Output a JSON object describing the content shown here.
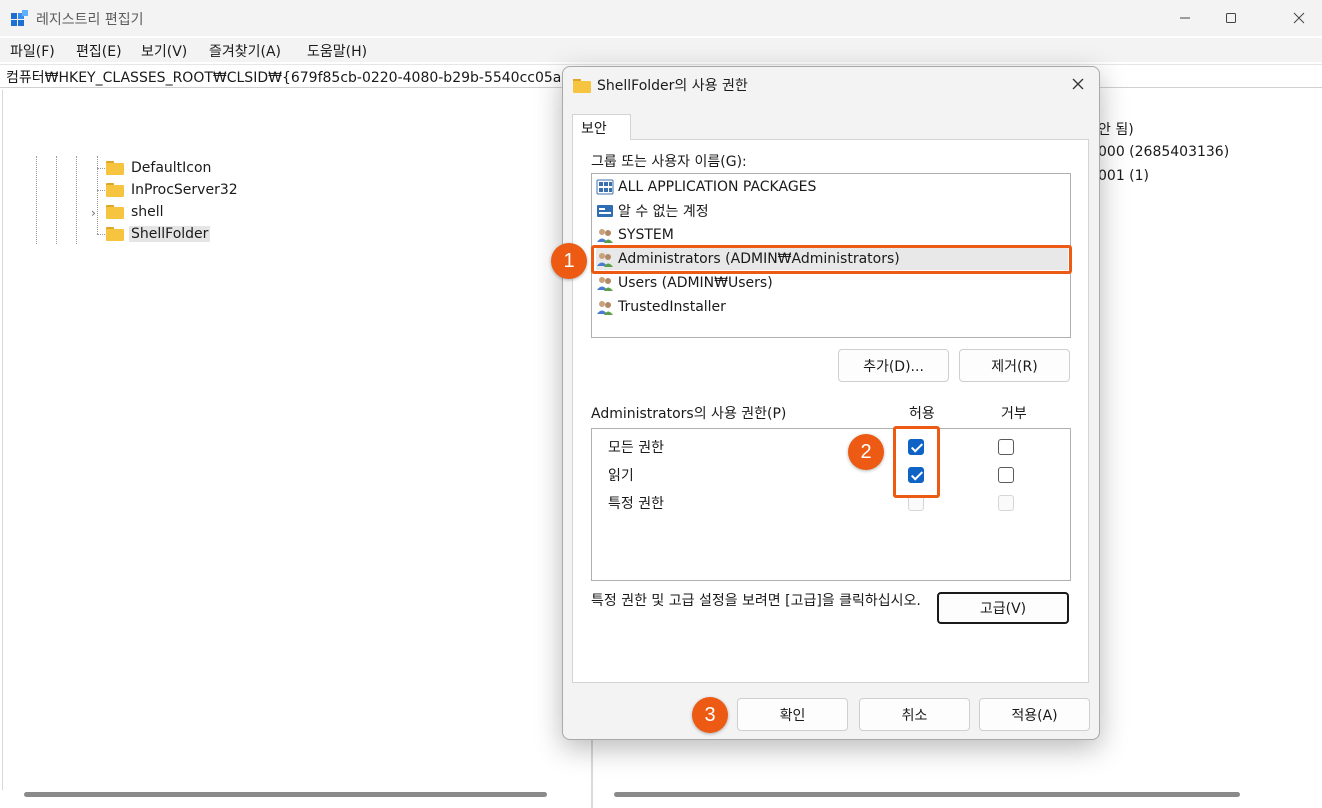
{
  "window": {
    "title": "레지스트리 편집기",
    "menu": [
      "파일(F)",
      "편집(E)",
      "보기(V)",
      "즐겨찾기(A)",
      "도움말(H)"
    ],
    "address": "컴퓨터₩HKEY_CLASSES_ROOT₩CLSID₩{679f85cb-0220-4080-b29b-5540cc05aab6}₩"
  },
  "tree": {
    "items": [
      {
        "label": "DefaultIcon",
        "icon": "folder-icon"
      },
      {
        "label": "InProcServer32",
        "icon": "folder-icon"
      },
      {
        "label": "shell",
        "icon": "folder-icon",
        "expandable": true
      },
      {
        "label": "ShellFolder",
        "icon": "folder-icon",
        "selected": true
      }
    ]
  },
  "values_pane": {
    "visible_fragments": [
      "안 됨)",
      "000 (2685403136)",
      "001 (1)"
    ]
  },
  "dialog": {
    "title": "ShellFolder의 사용 권한",
    "tab": "보안",
    "group_label": "그룹 또는 사용자 이름(G):",
    "users": [
      {
        "label": "ALL APPLICATION PACKAGES",
        "icon": "app-packages-icon"
      },
      {
        "label": "알 수 없는 계정",
        "icon": "unknown-account-icon"
      },
      {
        "label": "SYSTEM",
        "icon": "users-icon"
      },
      {
        "label": "Administrators (ADMIN₩Administrators)",
        "icon": "users-icon",
        "selected": true
      },
      {
        "label": "Users (ADMIN₩Users)",
        "icon": "users-icon"
      },
      {
        "label": "TrustedInstaller",
        "icon": "users-icon"
      }
    ],
    "add_button": "추가(D)...",
    "remove_button": "제거(R)",
    "permissions_label": "Administrators의 사용 권한(P)",
    "col_allow": "허용",
    "col_deny": "거부",
    "permissions": [
      {
        "label": "모든 권한",
        "allow": true,
        "deny": false,
        "enabled": true
      },
      {
        "label": "읽기",
        "allow": true,
        "deny": false,
        "enabled": true
      },
      {
        "label": "특정 권한",
        "allow": false,
        "deny": false,
        "enabled": false
      }
    ],
    "advanced_text": "특정 권한 및 고급 설정을 보려면 [고급]을 클릭하십시오.",
    "advanced_button": "고급(V)",
    "ok_button": "확인",
    "cancel_button": "취소",
    "apply_button": "적용(A)"
  },
  "annotations": {
    "badges": [
      "1",
      "2",
      "3"
    ],
    "color": "#ec5a13"
  },
  "colors": {
    "checkbox_checked": "#0f63c4",
    "folder": "#f7c440"
  }
}
